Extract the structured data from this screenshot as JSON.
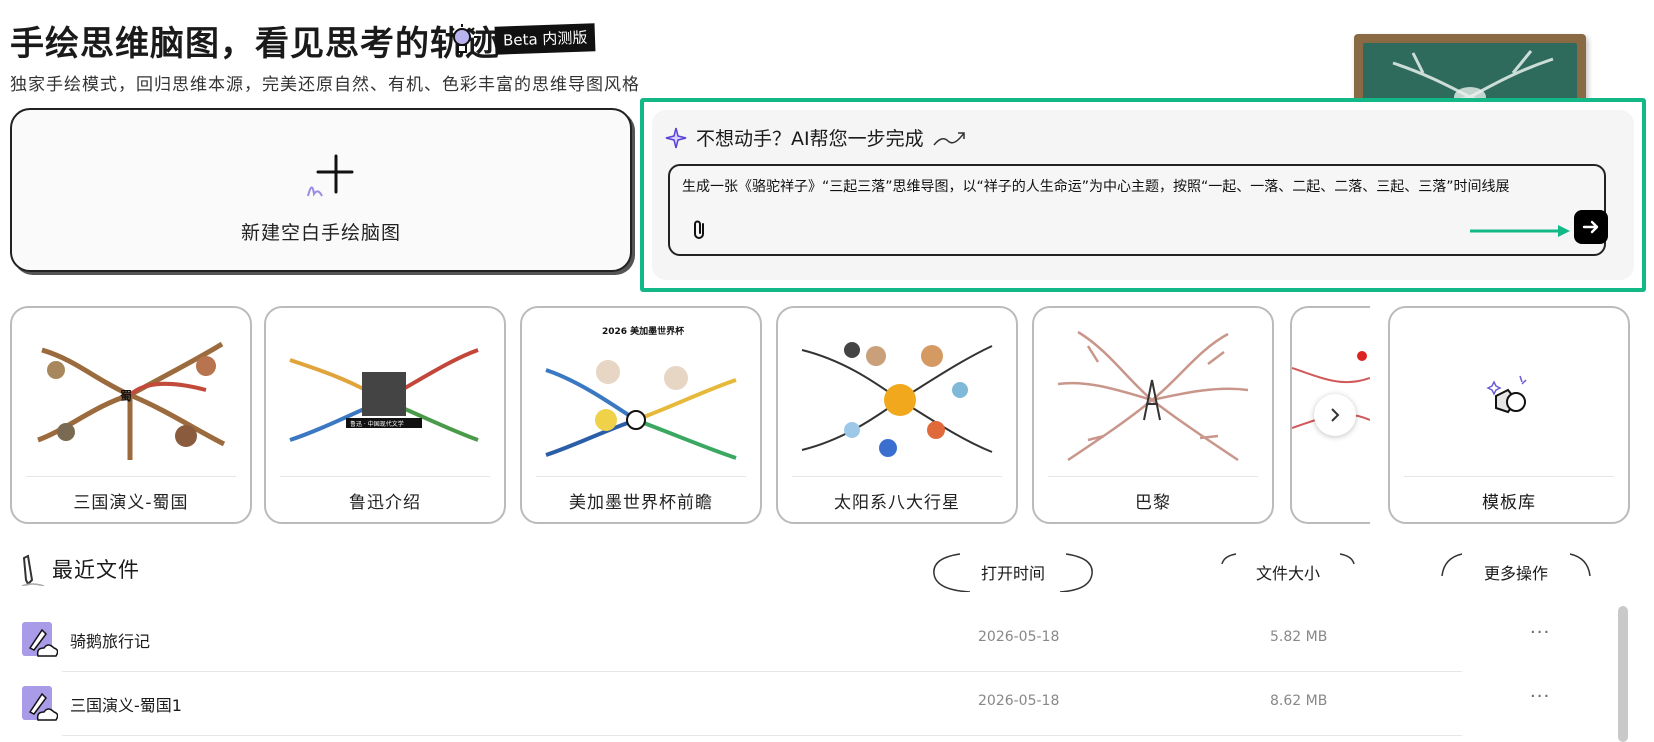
{
  "header": {
    "title": "手绘思维脑图，看见思考的轨迹",
    "beta_badge": "Beta 内测版",
    "subtitle": "独家手绘模式，回归思维本源，完美还原自然、有机、色彩丰富的思维导图风格"
  },
  "new_blank": {
    "label": "新建空白手绘脑图"
  },
  "ai": {
    "heading": "不想动手？AI帮您一步完成",
    "prompt_value": "生成一张《骆驼祥子》“三起三落”思维导图，以“祥子的人生命运”为中心主题，按照“一起、一落、二起、二落、三起、三落”时间线展",
    "accent": "#12b886"
  },
  "templates": [
    {
      "label": "三国演义-蜀国",
      "thumb_center": "蜀"
    },
    {
      "label": "鲁迅介绍",
      "thumb_center": "鲁迅 · 中国现代文学"
    },
    {
      "label": "美加墨世界杯前瞻",
      "thumb_center": "2026 美加墨世界杯"
    },
    {
      "label": "太阳系八大行星",
      "thumb_center": ""
    },
    {
      "label": "巴黎",
      "thumb_center": ""
    }
  ],
  "template_library": {
    "label": "模板库"
  },
  "recent": {
    "title": "最近文件",
    "columns": {
      "open_time": "打开时间",
      "size": "文件大小",
      "more": "更多操作"
    },
    "files": [
      {
        "name": "骑鹅旅行记",
        "date": "2026-05-18",
        "size": "5.82 MB",
        "more": "···"
      },
      {
        "name": "三国演义-蜀国1",
        "date": "2026-05-18",
        "size": "8.62 MB",
        "more": "···"
      }
    ]
  }
}
